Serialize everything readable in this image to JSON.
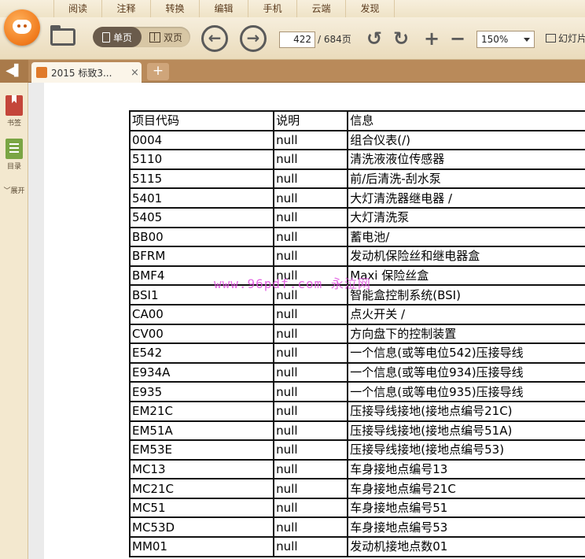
{
  "menu": {
    "tabs": [
      "阅读",
      "注释",
      "转换",
      "编辑",
      "手机",
      "云端",
      "发现"
    ]
  },
  "toolbar": {
    "single_page_label": "单页",
    "double_page_label": "双页",
    "current_page": "422",
    "page_total": "/ 684页",
    "zoom": "150%",
    "slideshow_label": "幻灯片"
  },
  "tabbar": {
    "doc_title": "2015 标致3...",
    "close_glyph": "×",
    "new_tab_glyph": "+"
  },
  "sidebar": {
    "bookmark_label": "书签",
    "toc_label": "目录",
    "expand_label": "展开"
  },
  "watermark": "www.96pdf.com 永泣网",
  "table": {
    "headers": [
      "项目代码",
      "说明",
      "信息"
    ],
    "rows": [
      [
        "0004",
        "null",
        "组合仪表(/)"
      ],
      [
        "5110",
        "null",
        "清洗液液位传感器"
      ],
      [
        "5115",
        "null",
        "前/后清洗-刮水泵"
      ],
      [
        "5401",
        "null",
        "大灯清洗器继电器 /"
      ],
      [
        "5405",
        "null",
        "大灯清洗泵"
      ],
      [
        "BB00",
        "null",
        "蓄电池/"
      ],
      [
        "BFRM",
        "null",
        "发动机保险丝和继电器盒"
      ],
      [
        "BMF4",
        "null",
        "Maxi 保险丝盒"
      ],
      [
        "BSI1",
        "null",
        "智能盒控制系统(BSI)"
      ],
      [
        "CA00",
        "null",
        "点火开关 /"
      ],
      [
        "CV00",
        "null",
        "方向盘下的控制装置"
      ],
      [
        "E542",
        "null",
        "一个信息(或等电位542)压接导线"
      ],
      [
        "E934A",
        "null",
        "一个信息(或等电位934)压接导线"
      ],
      [
        "E935",
        "null",
        "一个信息(或等电位935)压接导线"
      ],
      [
        "EM21C",
        "null",
        "压接导线接地(接地点编号21C)"
      ],
      [
        "EM51A",
        "null",
        "压接导线接地(接地点编号51A)"
      ],
      [
        "EM53E",
        "null",
        "压接导线接地(接地点编号53)"
      ],
      [
        "MC13",
        "null",
        "车身接地点编号13"
      ],
      [
        "MC21C",
        "null",
        "车身接地点编号21C"
      ],
      [
        "MC51",
        "null",
        "车身接地点编号51"
      ],
      [
        "MC53D",
        "null",
        "车身接地点编号53"
      ],
      [
        "MM01",
        "null",
        "发动机接地点数01"
      ]
    ]
  }
}
